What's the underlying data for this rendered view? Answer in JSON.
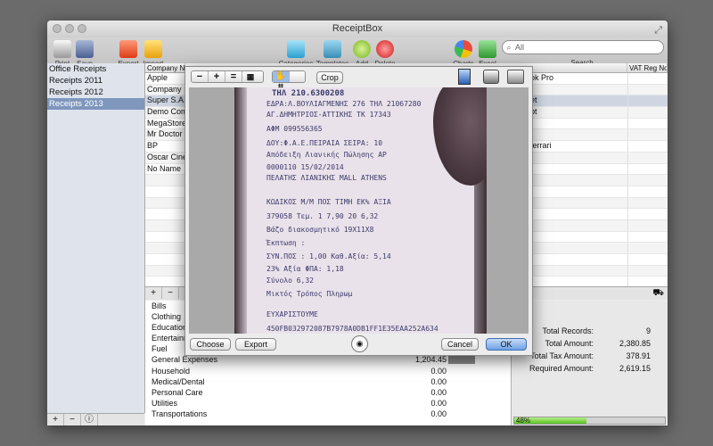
{
  "window": {
    "title": "ReceiptBox"
  },
  "toolbar": {
    "print": "Print",
    "save": "Save",
    "export": "Export",
    "import": "Import",
    "categories": "Categories",
    "templates": "Templates",
    "add": "Add",
    "delete": "Delete",
    "charts": "Charts",
    "excel": "Excel"
  },
  "search": {
    "placeholder": "All",
    "label": "Search"
  },
  "sidebar": {
    "items": [
      {
        "label": "Office  Receipts",
        "selected": false
      },
      {
        "label": "Receipts 2011",
        "selected": false
      },
      {
        "label": "Receipts 2012",
        "selected": false
      },
      {
        "label": "Receipts 2013",
        "selected": true
      }
    ],
    "add": "+",
    "remove": "−",
    "info": "ⓘ"
  },
  "table": {
    "headers": {
      "company": "Company Na",
      "vat": "VAT Reg No"
    },
    "rows": [
      {
        "company": "Apple",
        "right": "ok Pro"
      },
      {
        "company": "Company",
        "right": ""
      },
      {
        "company": "Super S.A.",
        "right": "et",
        "selected": true
      },
      {
        "company": "Demo Com",
        "right": "pt"
      },
      {
        "company": "MegaStore",
        "right": ""
      },
      {
        "company": "Mr Doctor",
        "right": ""
      },
      {
        "company": "BP",
        "right": " ferrari"
      },
      {
        "company": "Oscar Cine",
        "right": ""
      },
      {
        "company": "No Name",
        "right": ""
      },
      {
        "company": "",
        "right": ""
      },
      {
        "company": "",
        "right": ""
      },
      {
        "company": "",
        "right": ""
      },
      {
        "company": "",
        "right": ""
      },
      {
        "company": "",
        "right": ""
      },
      {
        "company": "",
        "right": ""
      },
      {
        "company": "",
        "right": ""
      },
      {
        "company": "",
        "right": ""
      },
      {
        "company": "",
        "right": ""
      },
      {
        "company": "",
        "right": ""
      },
      {
        "company": "",
        "right": ""
      }
    ],
    "add": "+",
    "remove": "−"
  },
  "categories": [
    {
      "name": "Bills",
      "amount": ""
    },
    {
      "name": "Clothing",
      "amount": ""
    },
    {
      "name": "Education",
      "amount": ""
    },
    {
      "name": "Entertainment",
      "amount": ""
    },
    {
      "name": "Fuel",
      "amount": ""
    },
    {
      "name": "General Expenses",
      "amount": "1,204.45",
      "share": 0.5
    },
    {
      "name": "Household",
      "amount": "0.00"
    },
    {
      "name": "Medical/Dental",
      "amount": "0.00"
    },
    {
      "name": "Personal Care",
      "amount": "0.00"
    },
    {
      "name": "Utilities",
      "amount": "0.00"
    },
    {
      "name": "Transportations",
      "amount": "0.00"
    }
  ],
  "stats": [
    {
      "label": "Total Records:",
      "value": "9"
    },
    {
      "label": "Total Amount:",
      "value": "2,380.85"
    },
    {
      "label": "Total Tax Amount:",
      "value": "378.91"
    },
    {
      "label": "Required Amount:",
      "value": "2,619.15"
    }
  ],
  "progress": {
    "percent": 48,
    "label": "48%"
  },
  "dialog": {
    "crop": "Crop",
    "choose": "Choose",
    "export": "Export",
    "cancel": "Cancel",
    "ok": "OK",
    "zoom_out": "−",
    "zoom_in": "+",
    "fit": "=",
    "receipt_lines": [
      "ΤΗΛ  210.6300208",
      "ΕΔΡΑ:Λ.ΒΟΥΛΙΑΓΜΕΝΗΣ 276 ΤΗΛ 21067280",
      "ΑΓ.ΔΗΜΗΤΡΙΟΣ-ΑΤΤΙΚΗΣ ΤΚ 17343",
      "ΑΦΜ 099556365",
      "ΔΟΥ:Φ.Α.Ε.ΠΕΙΡΑΙΑ          ΣΕΙΡΑ: 10",
      "  Απόδειξη Λιανικής Πώλησης      ΑΡ",
      "0000110              15/02/2014",
      "ΠΕΛΑΤΗΣ ΛΙΑΝΙΚΗΣ MALL ATHENS",
      "ΚΩΔΙΚΟΣ     Μ/Μ   ΠΟΣ   ΤΙΜΗ    ΕΚ%  ΑΞΙΑ",
      "379058      Τεμ.   1    7,90    20   6,32",
      "           Βάζο διακοσμητικό 19Χ11Χ8",
      "                          Έκπτωση :",
      "ΣΥΝ.ΠΟΣ :     1,00       Καθ.Αξία:      5,14",
      "                    23% Αξία ΦΠΑ:       1,18",
      "                          Σύνολο         6,32",
      "   Μικτός Τρόπος Πληρωμ",
      "                  ΕΥΧΑΡΙΣΤΟΥΜΕ",
      "450FB032972087B7978A0DB1FF1E35EAA252A634"
    ]
  },
  "colors": {
    "selection": "#7f97bd",
    "progress": "#56c21f",
    "default_button": "#6ea1e6"
  }
}
